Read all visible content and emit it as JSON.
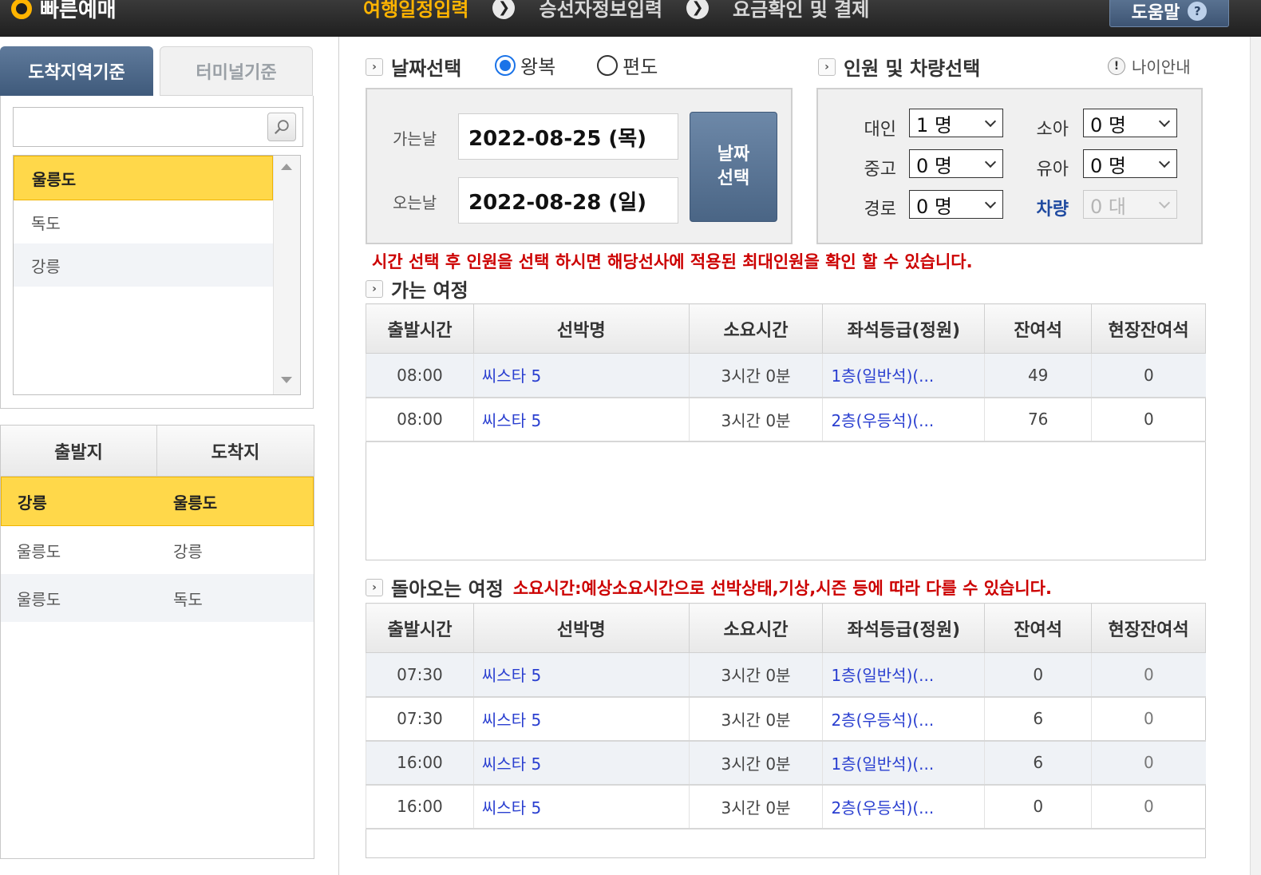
{
  "header": {
    "brand": "빠른예매",
    "steps": [
      "여행일정입력",
      "승선자정보입력",
      "요금확인 및 결제"
    ],
    "active_step": 0,
    "help_label": "도움말",
    "help_icon": "question-icon",
    "colors": {
      "accent": "#ffb400",
      "bar": "#2a2a2a"
    }
  },
  "left": {
    "tabs": [
      "도착지역기준",
      "터미널기준"
    ],
    "active_tab": 0,
    "search": {
      "value": "",
      "placeholder": ""
    },
    "destinations": [
      "울릉도",
      "독도",
      "강릉"
    ],
    "selected_destination": 0,
    "routes_header": [
      "출발지",
      "도착지"
    ],
    "routes": [
      [
        "강릉",
        "울릉도"
      ],
      [
        "울릉도",
        "강릉"
      ],
      [
        "울릉도",
        "독도"
      ]
    ],
    "selected_route": 0
  },
  "date": {
    "section_label": "날짜선택",
    "trip_types": [
      "왕복",
      "편도"
    ],
    "selected_trip_type": 0,
    "go_label": "가는날",
    "go_value": "2022-08-25 (목)",
    "return_label": "오는날",
    "return_value": "2022-08-28 (일)",
    "button_line1": "날짜",
    "button_line2": "선택"
  },
  "pax": {
    "section_label": "인원 및 차량선택",
    "info_label": "나이안내",
    "fields": [
      {
        "label": "대인",
        "value": "1 명"
      },
      {
        "label": "소아",
        "value": "0 명"
      },
      {
        "label": "중고",
        "value": "0 명"
      },
      {
        "label": "유아",
        "value": "0 명"
      },
      {
        "label": "경로",
        "value": "0 명"
      },
      {
        "label": "차량",
        "value": "0 대"
      }
    ]
  },
  "notice_people": "시간 선택 후 인원을 선택 하시면 해당선사에 적용된 최대인원을 확인 할 수 있습니다.",
  "outbound": {
    "title": "가는 여정",
    "columns": [
      "출발시간",
      "선박명",
      "소요시간",
      "좌석등급(정원)",
      "잔여석",
      "현장잔여석"
    ],
    "rows": [
      [
        "08:00",
        "씨스타 5",
        "3시간 0분",
        "1층(일반석)(...",
        "49",
        "0"
      ],
      [
        "08:00",
        "씨스타 5",
        "3시간 0분",
        "2층(우등석)(...",
        "76",
        "0"
      ]
    ]
  },
  "inbound": {
    "title": "돌아오는 여정",
    "note": "소요시간:예상소요시간으로 선박상태,기상,시즌 등에 따라 다를 수 있습니다.",
    "columns": [
      "출발시간",
      "선박명",
      "소요시간",
      "좌석등급(정원)",
      "잔여석",
      "현장잔여석"
    ],
    "rows": [
      [
        "07:30",
        "씨스타 5",
        "3시간 0분",
        "1층(일반석)(...",
        "0",
        "0"
      ],
      [
        "07:30",
        "씨스타 5",
        "3시간 0분",
        "2층(우등석)(...",
        "6",
        "0"
      ],
      [
        "16:00",
        "씨스타 5",
        "3시간 0분",
        "1층(일반석)(...",
        "6",
        "0"
      ],
      [
        "16:00",
        "씨스타 5",
        "3시간 0분",
        "2층(우등석)(...",
        "0",
        "0"
      ]
    ]
  }
}
